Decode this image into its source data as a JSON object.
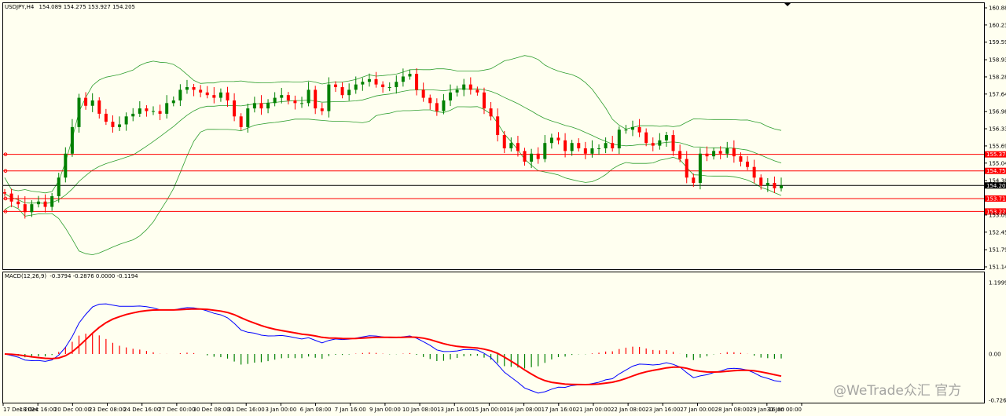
{
  "main_header": {
    "symbol_tf": "USDJPY,H4",
    "ohlc": "154.089 154.275 153.927 154.205"
  },
  "macd_header": {
    "label": "MACD(12,26,9)",
    "values": "-0.3794 -0.2876 0.0000 -0.1194"
  },
  "watermark": "@WeTrade众汇 官方",
  "price_axis": {
    "ticks": [
      "160.880",
      "160.235",
      "159.590",
      "158.930",
      "158.285",
      "157.640",
      "156.980",
      "156.335",
      "155.690",
      "155.045",
      "154.385",
      "153.095",
      "152.450",
      "151.790",
      "151.145"
    ]
  },
  "macd_axis": {
    "ticks": [
      "1.1999",
      "0.00",
      "-0.726"
    ]
  },
  "time_axis": {
    "labels": [
      "17 Dec 2024",
      "18 Dec 16:00",
      "20 Dec 00:00",
      "23 Dec 08:00",
      "24 Dec 16:00",
      "27 Dec 00:00",
      "30 Dec 08:00",
      "31 Dec 16:00",
      "3 Jan 00:00",
      "6 Jan 08:00",
      "7 Jan 16:00",
      "9 Jan 00:00",
      "10 Jan 08:00",
      "13 Jan 16:00",
      "15 Jan 00:00",
      "16 Jan 08:00",
      "17 Jan 16:00",
      "21 Jan 00:00",
      "22 Jan 08:00",
      "23 Jan 16:00",
      "27 Jan 00:00",
      "28 Jan 08:00",
      "29 Jan 16:00",
      "31 Jan 00:00"
    ]
  },
  "horizontal_levels": [
    {
      "price": 155.374,
      "label": "155.374",
      "color": "#FF0000"
    },
    {
      "price": 154.753,
      "label": "154.753",
      "color": "#FF0000"
    },
    {
      "price": 154.205,
      "label": "154.205",
      "color": "#000000"
    },
    {
      "price": 153.713,
      "label": "153.713",
      "color": "#FF0000"
    },
    {
      "price": 153.228,
      "label": "153.228",
      "color": "#FF0000"
    }
  ],
  "colors": {
    "background": "#FFFFF0",
    "bull": "#008000",
    "bear": "#FF0000",
    "bands": "#2E9E2E",
    "macd_line": "#0000FF",
    "signal_line": "#FF0000"
  },
  "chart_data": {
    "type": "candlestick",
    "title": "USDJPY,H4",
    "ylim": [
      151.145,
      161.0
    ],
    "closes": [
      153.9,
      153.6,
      153.5,
      153.2,
      153.5,
      153.6,
      153.4,
      153.8,
      154.5,
      155.4,
      156.4,
      157.5,
      157.2,
      157.4,
      156.9,
      156.6,
      156.4,
      156.5,
      156.8,
      156.9,
      157.1,
      157.0,
      157.0,
      156.9,
      157.3,
      157.4,
      157.8,
      157.9,
      157.8,
      157.7,
      157.6,
      157.5,
      157.7,
      157.4,
      156.8,
      156.4,
      157.1,
      157.3,
      157.1,
      157.3,
      157.5,
      157.6,
      157.4,
      157.3,
      157.3,
      157.8,
      157.1,
      157.0,
      158.0,
      157.9,
      157.6,
      157.8,
      158.0,
      158.1,
      158.2,
      158.0,
      157.9,
      157.9,
      158.1,
      158.3,
      158.4,
      157.8,
      157.5,
      157.3,
      157.0,
      157.4,
      157.7,
      157.8,
      158.0,
      157.8,
      157.7,
      157.1,
      156.8,
      156.1,
      155.6,
      155.8,
      155.5,
      155.1,
      155.4,
      155.2,
      155.8,
      156.0,
      155.9,
      155.5,
      155.8,
      155.6,
      155.4,
      155.6,
      155.6,
      155.8,
      155.6,
      156.3,
      156.3,
      156.4,
      156.2,
      155.8,
      155.7,
      155.9,
      156.1,
      155.5,
      155.2,
      154.5,
      154.3,
      155.4,
      155.3,
      155.5,
      155.4,
      155.6,
      155.3,
      155.1,
      154.9,
      154.5,
      154.2,
      154.3,
      154.1,
      154.2
    ]
  }
}
